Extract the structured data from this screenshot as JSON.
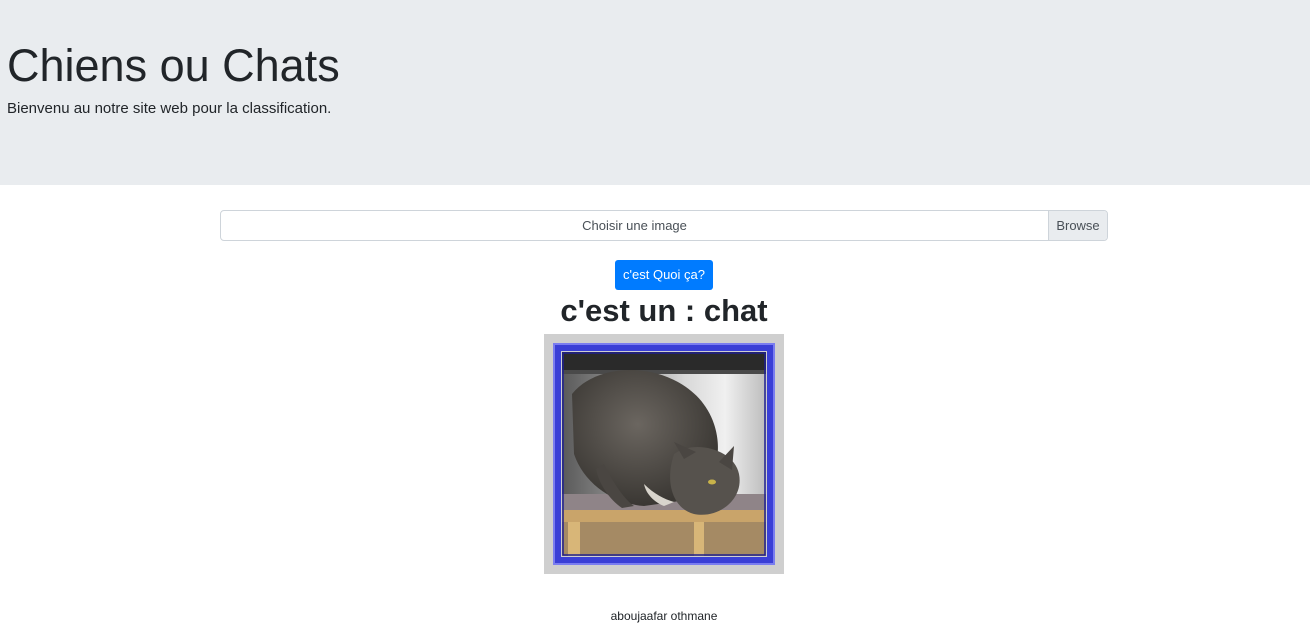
{
  "header": {
    "title": "Chiens ou Chats",
    "lead": "Bienvenu au notre site web pour la classification."
  },
  "upload": {
    "label": "Choisir une image",
    "browse_label": "Browse"
  },
  "submit": {
    "label": "c'est Quoi ça?"
  },
  "result": {
    "text": "c'est un : chat"
  },
  "image": {
    "subject": "cat",
    "frame_color": "#3a3fd6"
  },
  "footer": {
    "author": "aboujaafar othmane"
  },
  "colors": {
    "jumbotron_bg": "#e9ecef",
    "primary": "#007bff"
  }
}
